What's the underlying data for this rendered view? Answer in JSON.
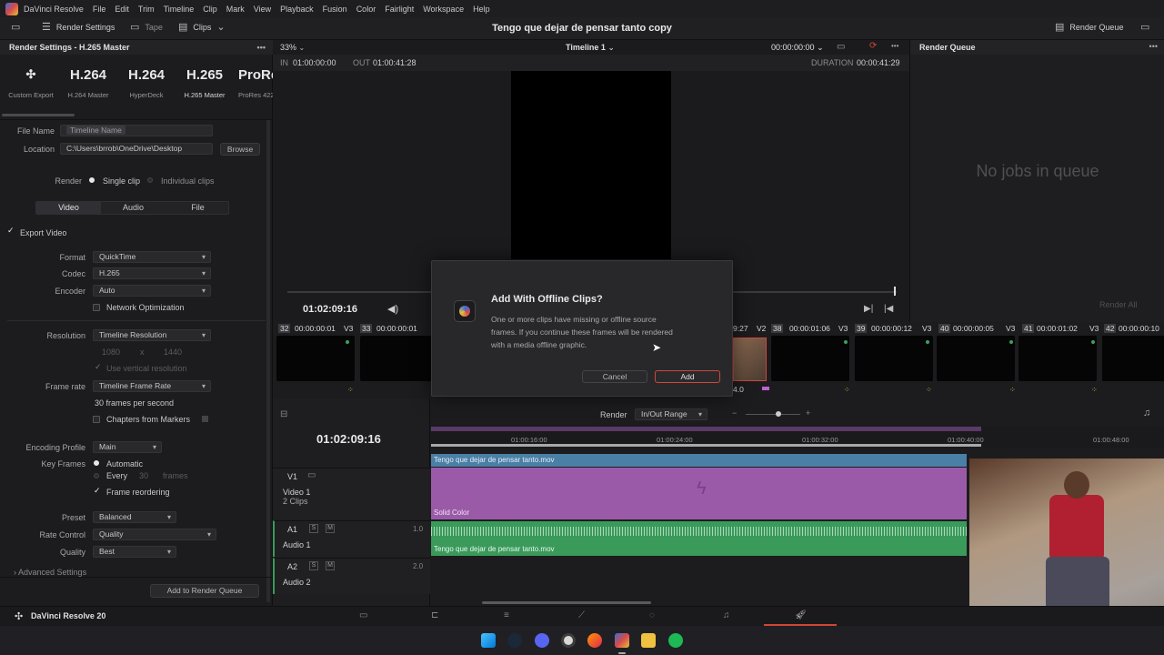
{
  "menubar": {
    "app_name": "DaVinci Resolve",
    "items": [
      "File",
      "Edit",
      "Trim",
      "Timeline",
      "Clip",
      "Mark",
      "View",
      "Playback",
      "Fusion",
      "Color",
      "Fairlight",
      "Workspace",
      "Help"
    ]
  },
  "toolbar": {
    "render_settings": "Render Settings",
    "tape": "Tape",
    "clips": "Clips",
    "project_title": "Tengo que dejar de pensar tanto copy",
    "render_queue": "Render Queue"
  },
  "render_settings": {
    "header": "Render Settings - H.265 Master",
    "presets": [
      {
        "big": "",
        "label": "Custom Export"
      },
      {
        "big": "H.264",
        "label": "H.264 Master"
      },
      {
        "big": "H.264",
        "label": "HyperDeck"
      },
      {
        "big": "H.265",
        "label": "H.265 Master"
      },
      {
        "big": "ProRe",
        "label": "ProRes 422"
      }
    ],
    "file_name_label": "File Name",
    "file_name_value": "Timeline Name",
    "location_label": "Location",
    "location_value": "C:\\Users\\brrob\\OneDrive\\Desktop",
    "browse": "Browse",
    "render_label": "Render",
    "single_clip": "Single clip",
    "individual_clips": "Individual clips",
    "tabs": [
      "Video",
      "Audio",
      "File"
    ],
    "export_video": "Export Video",
    "format_label": "Format",
    "format_value": "QuickTime",
    "codec_label": "Codec",
    "codec_value": "H.265",
    "encoder_label": "Encoder",
    "encoder_value": "Auto",
    "network_opt": "Network Optimization",
    "resolution_label": "Resolution",
    "resolution_value": "Timeline Resolution",
    "res_w": "1080",
    "res_x": "x",
    "res_h": "1440",
    "vertical_res": "Use vertical resolution",
    "frame_rate_label": "Frame rate",
    "frame_rate_value": "Timeline Frame Rate",
    "fps_text": "30 frames per second",
    "chapters": "Chapters from Markers",
    "encoding_profile_label": "Encoding Profile",
    "encoding_profile_value": "Main",
    "key_frames_label": "Key Frames",
    "automatic": "Automatic",
    "every": "Every",
    "every_value": "30",
    "frames": "frames",
    "frame_reordering": "Frame reordering",
    "preset_label": "Preset",
    "preset_value": "Balanced",
    "rate_control_label": "Rate Control",
    "rate_control_value": "Quality",
    "quality_label": "Quality",
    "quality_value": "Best",
    "advanced": "Advanced Settings",
    "add_queue": "Add to Render Queue"
  },
  "viewer": {
    "zoom": "33%",
    "timeline_name": "Timeline 1",
    "timecode_top": "00:00:00:00",
    "in_label": "IN",
    "in_value": "01:00:00:00",
    "out_label": "OUT",
    "out_value": "01:00:41:28",
    "duration_label": "DURATION",
    "duration_value": "00:00:41:29",
    "playhead_tc": "01:02:09:16"
  },
  "queue": {
    "empty": "No jobs in queue",
    "render_all": "Render All"
  },
  "thumbs": [
    {
      "num": "32",
      "tc": "00:00:00:01",
      "track": "V3"
    },
    {
      "num": "33",
      "tc": "00:00:00:01",
      "track": ""
    },
    {
      "num": "38",
      "tc": "00:00:01:06",
      "track": "V3"
    },
    {
      "num": "39",
      "tc": "00:00:00:12",
      "track": "V3"
    },
    {
      "num": "40",
      "tc": "00:00:00:05",
      "track": "V3"
    },
    {
      "num": "41",
      "tc": "00:00:01:02",
      "track": "V3"
    },
    {
      "num": "42",
      "tc": "00:00:00:10",
      "track": ""
    }
  ],
  "thumb_partial": {
    "tc": "9:27",
    "track": "V2",
    "value": "4.0"
  },
  "timeline": {
    "render_label": "Render",
    "range_value": "In/Out Range",
    "playhead_tc": "01:02:09:16",
    "ruler": [
      "01:00:16:00",
      "01:00:24:00",
      "01:00:32:00",
      "01:00:40:00",
      "01:00:48:00"
    ],
    "v1": "V1",
    "video1": "Video 1",
    "clips": "2 Clips",
    "a1": "A1",
    "audio1": "Audio 1",
    "a1_level": "1.0",
    "a2": "A2",
    "audio2": "Audio 2",
    "a2_level": "2.0",
    "s": "S",
    "m": "M",
    "clip_top": "Tengo que dejar de pensar tanto.mov",
    "clip_solid": "Solid Color",
    "clip_audio": "Tengo que dejar de pensar tanto.mov"
  },
  "pagebar": {
    "brand": "DaVinci Resolve 20"
  },
  "dialog": {
    "title": "Add With Offline Clips?",
    "body": "One or more clips have missing or offline source frames. If you continue these frames will be rendered with a media offline graphic.",
    "cancel": "Cancel",
    "add": "Add"
  },
  "colors": {
    "accent_red": "#d0463a",
    "purple_clip": "#9b5aa8",
    "audio_green": "#3a9a5a",
    "video_blue": "#4a7fa6"
  }
}
